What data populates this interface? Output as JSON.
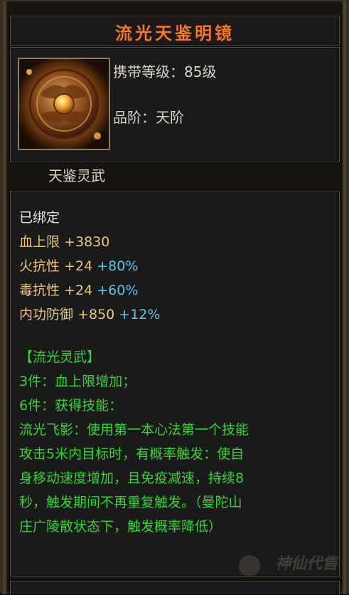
{
  "item": {
    "name": "流光天鉴明镜",
    "carry_level_label": "携带等级：",
    "carry_level_value": "85级",
    "grade_label": "品阶：",
    "grade_value": "天阶",
    "set_series": "天鉴灵武",
    "bound_status": "已绑定",
    "icon": "bronze-mirror-icon"
  },
  "stats": [
    {
      "name": "血上限",
      "value": "+3830",
      "bonus": ""
    },
    {
      "name": "火抗性",
      "value": "+24",
      "bonus": "+80%"
    },
    {
      "name": "毒抗性",
      "value": "+24",
      "bonus": "+60%"
    },
    {
      "name": "内功防御",
      "value": "+850",
      "bonus": "+12%"
    }
  ],
  "set_bonus": {
    "title": "【流光灵武】",
    "piece3": "3件：血上限增加；",
    "piece6": "6件：获得技能：",
    "skill_lines": [
      "流光飞影：使用第一本心法第一个技能",
      "攻击5米内目标时，有概率触发：使自",
      "身移动速度增加，且免疫减速，持续8",
      "秒，触发期间不再重复触发。（曼陀山",
      "庄广陵散状态下，触发概率降低）"
    ]
  },
  "watermark": "神仙代售",
  "colors": {
    "title": "#f07a2a",
    "stat_value": "#ecc37c",
    "stat_bonus": "#55c8f0",
    "set_text": "#33d632"
  }
}
